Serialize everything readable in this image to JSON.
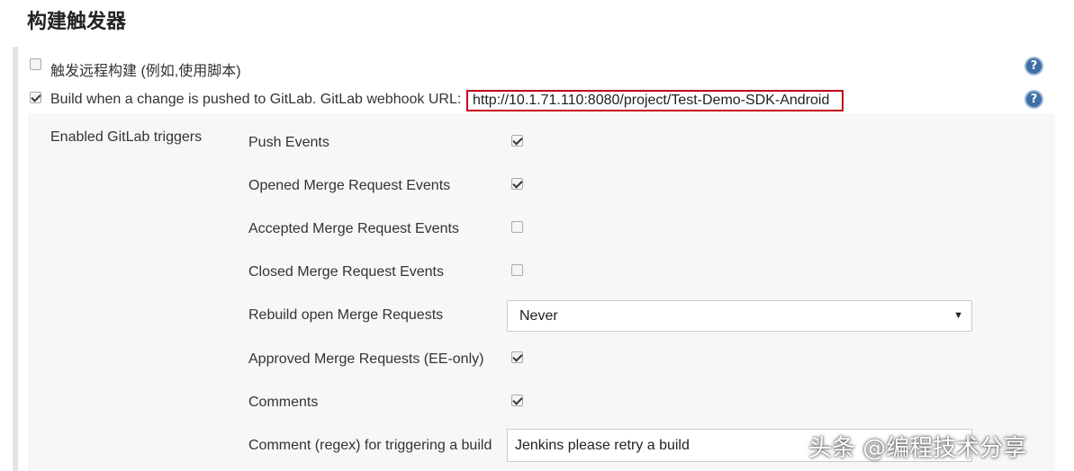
{
  "section": {
    "title": "构建触发器"
  },
  "triggers": {
    "remote": {
      "label": "触发远程构建 (例如,使用脚本)",
      "checked": false
    },
    "gitlab": {
      "label": "Build when a change is pushed to GitLab. GitLab webhook URL:",
      "checked": true,
      "webhook_url": "http://10.1.71.110:8080/project/Test-Demo-SDK-Android"
    }
  },
  "gitlab_panel": {
    "heading": "Enabled GitLab triggers",
    "options": [
      {
        "label": "Push Events",
        "checked": true
      },
      {
        "label": "Opened Merge Request Events",
        "checked": true
      },
      {
        "label": "Accepted Merge Request Events",
        "checked": false
      },
      {
        "label": "Closed Merge Request Events",
        "checked": false
      },
      {
        "label": "Rebuild open Merge Requests",
        "type": "select",
        "value": "Never"
      },
      {
        "label": "Approved Merge Requests (EE-only)",
        "checked": true
      },
      {
        "label": "Comments",
        "checked": true
      },
      {
        "label": "Comment (regex) for triggering a build",
        "type": "text",
        "value": "Jenkins please retry a build"
      }
    ]
  },
  "help_icon_glyph": "?",
  "watermark": "头条 @编程技术分享",
  "colors": {
    "highlight_border": "#c0001a",
    "help_icon": "#3f6fa3"
  }
}
